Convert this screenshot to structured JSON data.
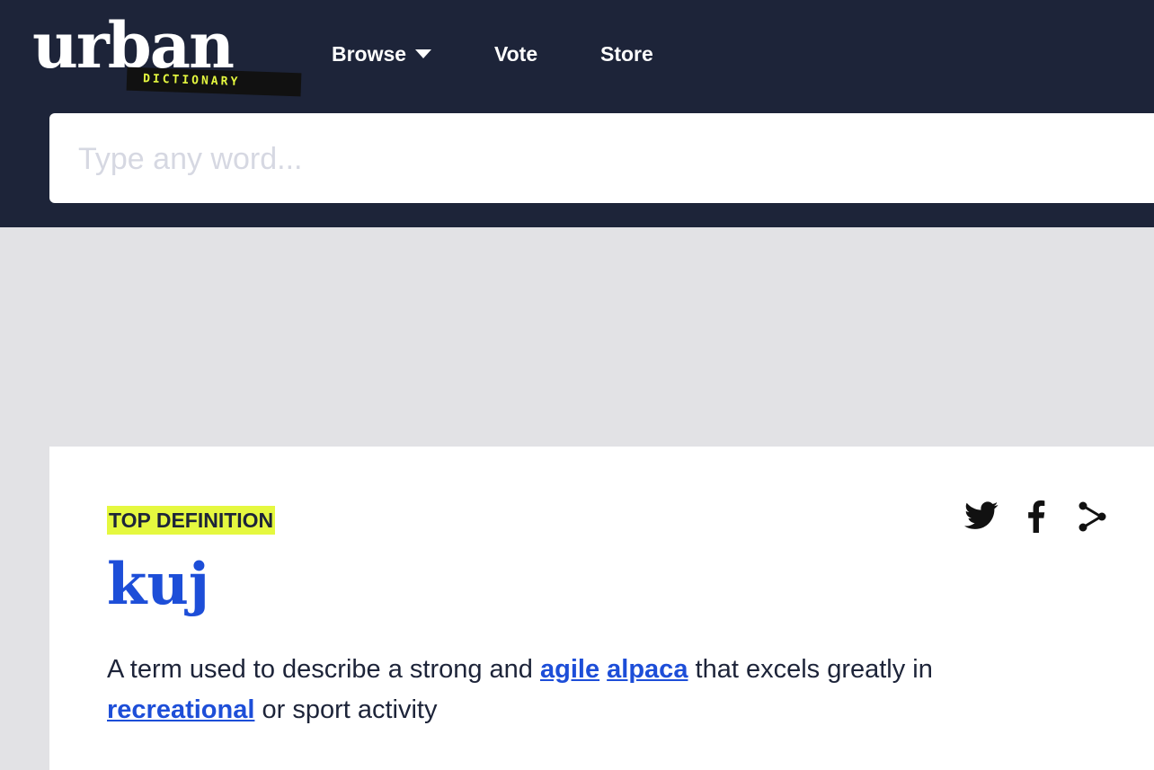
{
  "header": {
    "logo": {
      "word": "urban",
      "tagline": "DICTIONARY"
    },
    "nav": [
      {
        "label": "Browse"
      },
      {
        "label": "Vote"
      },
      {
        "label": "Store"
      }
    ],
    "search": {
      "placeholder": "Type any word...",
      "value": ""
    }
  },
  "definition_card": {
    "badge": "TOP DEFINITION",
    "word": "kuj",
    "definition": {
      "part1": "A term used to describe a strong and ",
      "link1": "agile",
      "link2": "alpaca",
      "part2": " that excels greatly in ",
      "link3": "recreational",
      "part3": " or sport activity"
    },
    "share_icons": [
      "twitter-icon",
      "facebook-icon",
      "share-icon"
    ]
  },
  "colors": {
    "header_bg": "#1d2439",
    "page_bg": "#e2e2e5",
    "accent_yellow": "#e5f83f",
    "link_blue": "#1d4ed8"
  }
}
